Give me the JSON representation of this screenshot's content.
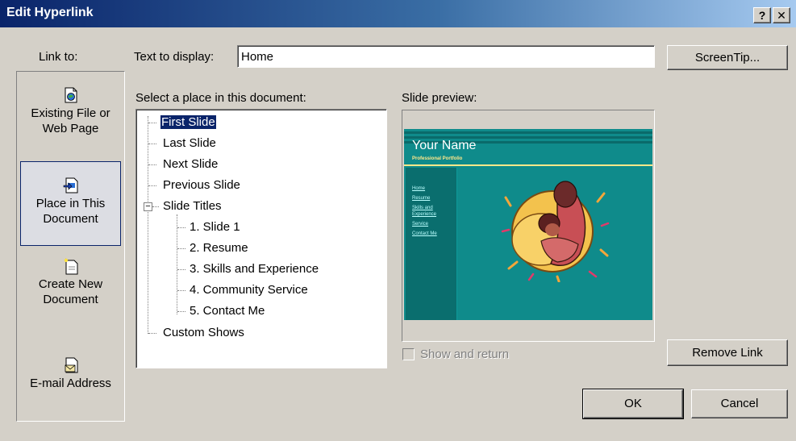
{
  "window": {
    "title": "Edit Hyperlink",
    "help_button": "?",
    "close_button": "✕"
  },
  "link_to": {
    "label": "Link to:",
    "items": [
      {
        "line1": "Existing File or",
        "line2": "Web Page",
        "icon": "existing-file-icon",
        "selected": false
      },
      {
        "line1": "Place in This",
        "line2": "Document",
        "icon": "place-in-document-icon",
        "selected": true
      },
      {
        "line1": "Create New",
        "line2": "Document",
        "icon": "create-new-document-icon",
        "selected": false
      },
      {
        "line1": "E-mail Address",
        "line2": "",
        "icon": "email-address-icon",
        "selected": false
      }
    ]
  },
  "text_to_display": {
    "label": "Text to display:",
    "value": "Home"
  },
  "screentip_button": "ScreenTip...",
  "select_place": {
    "label": "Select a place in this document:",
    "tree": [
      {
        "text": "First Slide",
        "selected": true
      },
      {
        "text": "Last Slide"
      },
      {
        "text": "Next Slide"
      },
      {
        "text": "Previous Slide"
      },
      {
        "text": "Slide Titles",
        "expanded": true,
        "expander": "−"
      },
      {
        "text": "1. Slide 1"
      },
      {
        "text": "2. Resume"
      },
      {
        "text": "3. Skills and Experience"
      },
      {
        "text": "4. Community Service"
      },
      {
        "text": "5. Contact Me"
      },
      {
        "text": "Custom Shows"
      }
    ]
  },
  "preview": {
    "label": "Slide preview:",
    "slide": {
      "title": "Your Name",
      "subtitle": "Professional Portfolio",
      "links": [
        "Home",
        "Resume",
        "Skills and",
        "Experience",
        "Service",
        "Contact Me"
      ],
      "background_color": "#0f8b8b"
    }
  },
  "show_and_return": {
    "label": "Show and return",
    "checked": false,
    "enabled": false
  },
  "buttons": {
    "remove_link": "Remove Link",
    "ok": "OK",
    "cancel": "Cancel"
  },
  "colors": {
    "titlebar_start": "#0a246a",
    "titlebar_end": "#a6caf0",
    "dialog_face": "#d4d0c8",
    "selection": "#0a246a"
  }
}
